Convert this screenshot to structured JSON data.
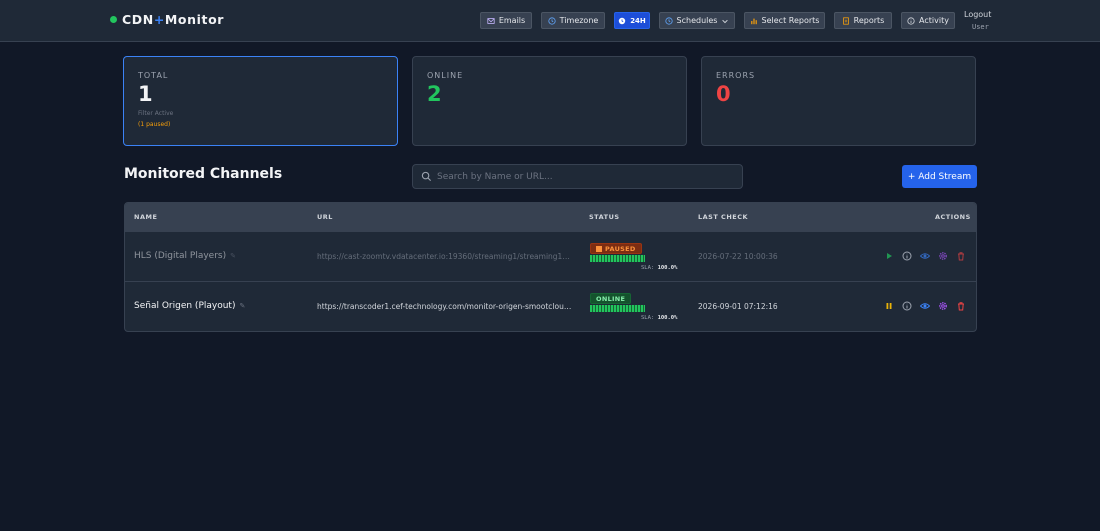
{
  "brand": {
    "name_a": "CDN",
    "plus": "+",
    "name_b": "Monitor"
  },
  "nav": {
    "emails": "Emails",
    "timezone": "Timezone",
    "h24": "24H",
    "schedules": "Schedules",
    "select_reports": "Select Reports",
    "reports": "Reports",
    "activity": "Activity",
    "logout": "Logout",
    "user": "User"
  },
  "stats": {
    "total": {
      "label": "TOTAL",
      "value": "1",
      "sub": "Filter Active",
      "paused": "(1 paused)"
    },
    "online": {
      "label": "ONLINE",
      "value": "2"
    },
    "errors": {
      "label": "ERRORS",
      "value": "0"
    }
  },
  "section": {
    "title": "Monitored Channels",
    "search_placeholder": "Search by Name or URL...",
    "add_button": "+ Add Stream"
  },
  "table": {
    "columns": {
      "name": "NAME",
      "url": "URL",
      "status": "STATUS",
      "last_check": "LAST CHECK",
      "actions": "ACTIONS"
    },
    "rows": [
      {
        "name": "HLS (Digital Players)",
        "url": "https://cast-zoomtv.vdatacenter.io:19360/streaming1/streaming1.m3u8",
        "status": "PAUSED",
        "sla_label": "SLA:",
        "sla_value": "100.0%",
        "last_check": "2026-07-22 10:00:36"
      },
      {
        "name": "Señal Origen (Playout)",
        "url": "https://transcoder1.cef-technology.com/monitor-origen-smootcloud.m3u8",
        "status": "ONLINE",
        "sla_label": "SLA:",
        "sla_value": "100.0%",
        "last_check": "2026-09-01 07:12:16"
      }
    ]
  },
  "colors": {
    "background": "#111827",
    "panel": "#1f2937",
    "accent": "#2563eb",
    "online": "#22c55e",
    "error": "#ef4444",
    "paused": "#f59e0b"
  }
}
